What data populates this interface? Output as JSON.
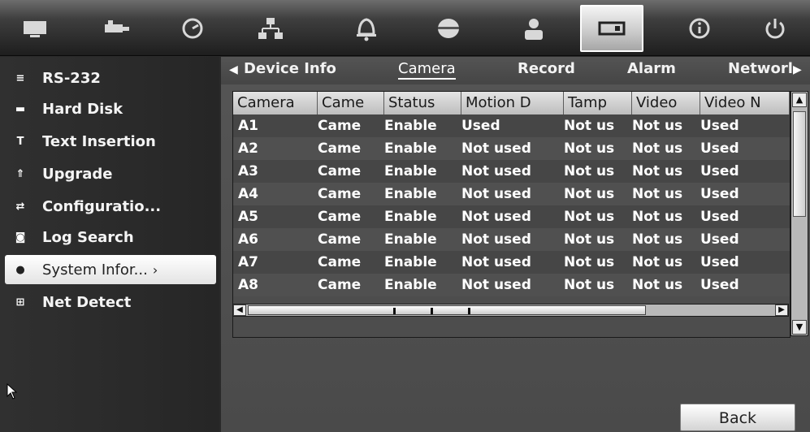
{
  "toolbar": {
    "icons": [
      "display-settings-icon",
      "camera-icon",
      "clock-icon",
      "network-icon",
      "alarm-bell-icon",
      "device-icon",
      "user-icon",
      "system-icon",
      "info-icon",
      "power-icon"
    ],
    "active_index": 7
  },
  "sidebar": {
    "items": [
      {
        "label": "RS-232",
        "icon": "rs232-icon"
      },
      {
        "label": "Hard Disk",
        "icon": "hard-disk-icon"
      },
      {
        "label": "Text Insertion",
        "icon": "text-insertion-icon"
      },
      {
        "label": "Upgrade",
        "icon": "upgrade-icon"
      },
      {
        "label": "Configuratio...",
        "icon": "configuration-icon"
      },
      {
        "label": "Log Search",
        "icon": "log-search-icon"
      },
      {
        "label": "System Infor...",
        "icon": "system-info-icon",
        "selected": true
      },
      {
        "label": "Net Detect",
        "icon": "net-detect-icon"
      }
    ]
  },
  "tabs": {
    "items": [
      "Device Info",
      "Camera",
      "Record",
      "Alarm",
      "Networl"
    ],
    "active": "Camera"
  },
  "table": {
    "headers": [
      "Camera",
      "Came",
      "Status",
      "Motion D",
      "Tamp",
      "Video",
      "Video N"
    ],
    "rows": [
      [
        "A1",
        "Came",
        "Enable",
        "Used",
        "Not us",
        "Not us",
        "Used"
      ],
      [
        "A2",
        "Came",
        "Enable",
        "Not used",
        "Not us",
        "Not us",
        "Used"
      ],
      [
        "A3",
        "Came",
        "Enable",
        "Not used",
        "Not us",
        "Not us",
        "Used"
      ],
      [
        "A4",
        "Came",
        "Enable",
        "Not used",
        "Not us",
        "Not us",
        "Used"
      ],
      [
        "A5",
        "Came",
        "Enable",
        "Not used",
        "Not us",
        "Not us",
        "Used"
      ],
      [
        "A6",
        "Came",
        "Enable",
        "Not used",
        "Not us",
        "Not us",
        "Used"
      ],
      [
        "A7",
        "Came",
        "Enable",
        "Not used",
        "Not us",
        "Not us",
        "Used"
      ],
      [
        "A8",
        "Came",
        "Enable",
        "Not used",
        "Not us",
        "Not us",
        "Used"
      ]
    ]
  },
  "footer": {
    "back_label": "Back"
  },
  "colors": {
    "panel": "#4a4a4a",
    "sidebar": "#2a2a2a",
    "highlight": "#ffffff"
  }
}
